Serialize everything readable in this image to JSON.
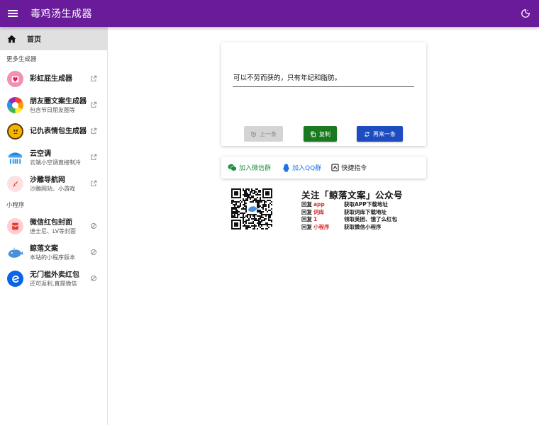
{
  "app": {
    "title": "毒鸡汤生成器"
  },
  "sidebar": {
    "home_label": "首页",
    "section_more": "更多生成器",
    "section_mini": "小程序",
    "generators": [
      {
        "name": "彩虹屁生成器",
        "sub": "",
        "icon": "heart-icon"
      },
      {
        "name": "朋友圈文案生成器",
        "sub": "包含节日朋友圈等",
        "icon": "aperture-icon"
      },
      {
        "name": "记仇表情包生成器",
        "sub": "",
        "icon": "angry-face-icon"
      },
      {
        "name": "云空调",
        "sub": "云端小空调直接制冷",
        "icon": "air-conditioner-icon"
      },
      {
        "name": "沙雕导航网",
        "sub": "沙雕网站、小游戏",
        "icon": "compass-icon"
      }
    ],
    "miniprograms": [
      {
        "name": "微信红包封面",
        "sub": "迪士尼、LV等封面",
        "icon": "red-envelope-icon"
      },
      {
        "name": "鲸落文案",
        "sub": "本站的小程序版本",
        "icon": "whale-icon"
      },
      {
        "name": "无门槛外卖红包",
        "sub": "还可返利,直提微信",
        "icon": "e-logo-icon"
      }
    ]
  },
  "generator": {
    "quote": "可以不劳而获的，只有年纪和脂肪。",
    "prev_label": "上一条",
    "copy_label": "复制",
    "next_label": "再来一条"
  },
  "links": {
    "wechat_group": "加入微信群",
    "qq_group": "加入QQ群",
    "shortcut": "快捷指令"
  },
  "promo": {
    "follow": "关注「鲸落文案」公众号",
    "replies": [
      {
        "prefix": "回复",
        "keyword": "app",
        "desc": "获取APP下载地址"
      },
      {
        "prefix": "回复",
        "keyword": "词库",
        "desc": "获取词库下载地址"
      },
      {
        "prefix": "回复",
        "keyword": "1",
        "desc": "领取美团、饿了么红包"
      },
      {
        "prefix": "回复",
        "keyword": "小程序",
        "desc": "获取微信小程序"
      }
    ]
  },
  "colors": {
    "appbar": "#6a1b9a",
    "copy": "#1b7a1f",
    "next": "#1c4cbf",
    "keyword": "#d32f2f"
  }
}
